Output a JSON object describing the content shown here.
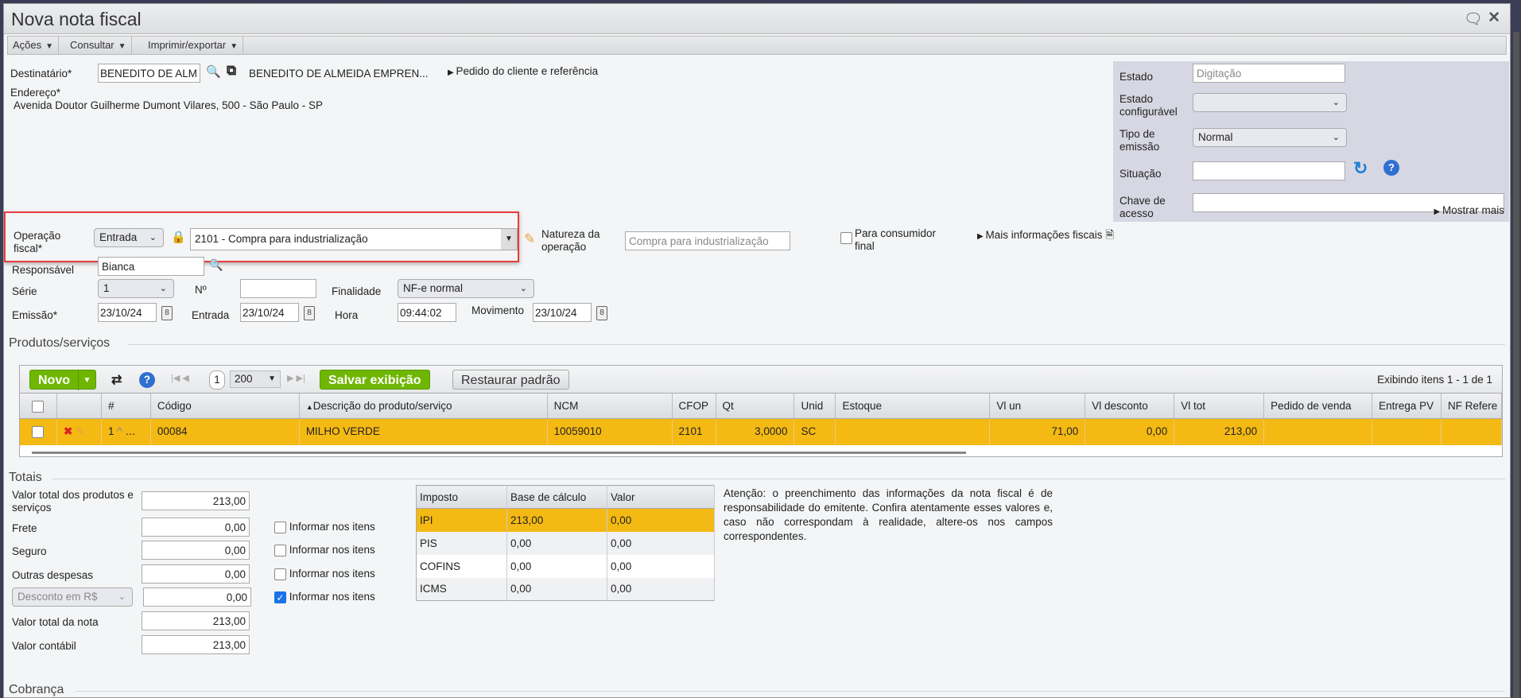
{
  "window": {
    "title": "Nova nota fiscal"
  },
  "menubar": [
    {
      "label": "Ações"
    },
    {
      "label": "Consultar"
    },
    {
      "label": "Imprimir/exportar"
    }
  ],
  "header": {
    "destinatario_label": "Destinatário*",
    "destinatario_value": "BENEDITO DE ALMEIDA",
    "destinatario_name": "BENEDITO DE ALMEIDA EMPREN...",
    "pedido_link": "Pedido do cliente e referência",
    "endereco_label": "Endereço*",
    "endereco_value": "Avenida Doutor Guilherme Dumont Vilares, 500 - São Paulo - SP"
  },
  "status_panel": {
    "estado_label": "Estado",
    "estado_value": "Digitação",
    "estado_conf_label": "Estado configurável",
    "estado_conf_value": "",
    "tipo_emissao_label": "Tipo de emissão",
    "tipo_emissao_value": "Normal",
    "situacao_label": "Situação",
    "situacao_value": "",
    "chave_label": "Chave de acesso",
    "chave_value": "",
    "mostrar_mais": "Mostrar mais"
  },
  "operacao": {
    "label": "Operação fiscal*",
    "tipo": "Entrada",
    "value": "2101 - Compra para industrialização",
    "natureza_label": "Natureza da operação",
    "natureza_value": "Compra para industrialização",
    "consumidor_label": "Para consumidor final",
    "mais_info": "Mais informações fiscais"
  },
  "fields": {
    "responsavel_label": "Responsável",
    "responsavel_value": "Bianca",
    "serie_label": "Série",
    "serie_value": "1",
    "numero_label": "Nº",
    "numero_value": "",
    "finalidade_label": "Finalidade",
    "finalidade_value": "NF-e normal",
    "emissao_label": "Emissão*",
    "emissao_value": "23/10/24",
    "entrada_label": "Entrada",
    "entrada_value": "23/10/24",
    "hora_label": "Hora",
    "hora_value": "09:44:02",
    "movimento_label": "Movimento",
    "movimento_value": "23/10/24"
  },
  "produtos": {
    "title": "Produtos/serviços",
    "novo": "Novo",
    "page": "1",
    "page_size": "200",
    "salvar": "Salvar exibição",
    "restaurar": "Restaurar padrão",
    "exibindo": "Exibindo itens 1 - 1 de 1",
    "columns": [
      "#",
      "Código",
      "Descrição do produto/serviço",
      "NCM",
      "CFOP",
      "Qt",
      "Unid",
      "Estoque",
      "Vl un",
      "Vl desconto",
      "Vl tot",
      "Pedido de venda",
      "Entrega PV",
      "NF Refere"
    ],
    "rows": [
      {
        "num": "1",
        "codigo": "00084",
        "descricao": "MILHO VERDE",
        "ncm": "10059010",
        "cfop": "2101",
        "qt": "3,0000",
        "unid": "SC",
        "estoque": "",
        "vl_un": "71,00",
        "vl_desc": "0,00",
        "vl_tot": "213,00",
        "pedido": "",
        "entrega": "",
        "nf_ref": ""
      }
    ]
  },
  "totais": {
    "title": "Totais",
    "valor_produtos_label": "Valor total dos produtos e serviços",
    "valor_produtos": "213,00",
    "frete_label": "Frete",
    "frete": "0,00",
    "seguro_label": "Seguro",
    "seguro": "0,00",
    "outras_label": "Outras despesas",
    "outras": "0,00",
    "desconto_tipo": "Desconto em R$",
    "desconto": "0,00",
    "valor_nota_label": "Valor total da nota",
    "valor_nota": "213,00",
    "valor_contabil_label": "Valor contábil",
    "valor_contabil": "213,00",
    "informar_label": "Informar nos itens",
    "informar_checked": [
      false,
      false,
      false,
      true
    ]
  },
  "impostos": {
    "columns": [
      "Imposto",
      "Base de cálculo",
      "Valor"
    ],
    "rows": [
      [
        "IPI",
        "213,00",
        "0,00"
      ],
      [
        "PIS",
        "0,00",
        "0,00"
      ],
      [
        "COFINS",
        "0,00",
        "0,00"
      ],
      [
        "ICMS",
        "0,00",
        "0,00"
      ]
    ]
  },
  "aviso": "Atenção: o preenchimento das informações da nota fiscal é de responsabilidade do emitente. Confira atentamente esses valores e, caso não correspondam à realidade, altere-os nos campos correspondentes.",
  "cobranca": {
    "title": "Cobrança"
  },
  "colors": {
    "highlight": "#f4b913",
    "green": "#6fb600",
    "red_box": "#e53d3d",
    "panel": "#d7d7e3"
  }
}
